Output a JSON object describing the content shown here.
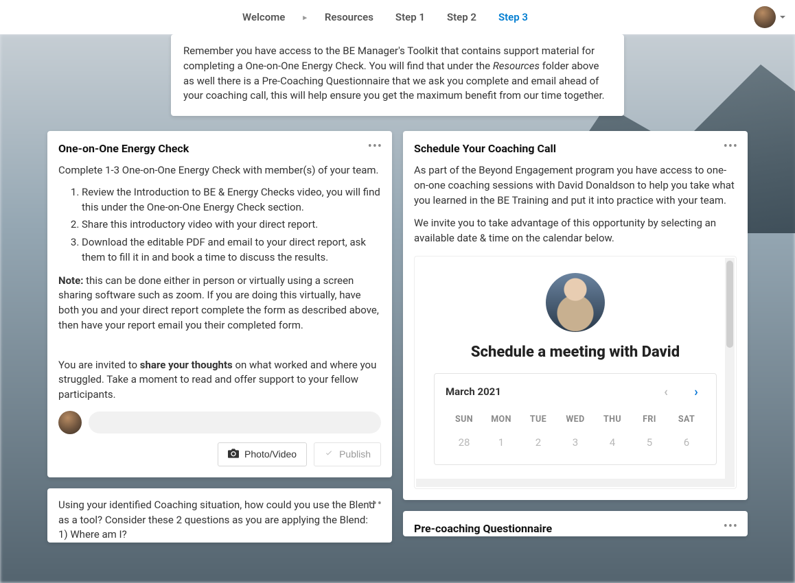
{
  "nav": {
    "items": [
      {
        "label": "Welcome"
      },
      {
        "label": "Resources"
      },
      {
        "label": "Step 1"
      },
      {
        "label": "Step 2"
      },
      {
        "label": "Step 3"
      }
    ],
    "active_index": 4
  },
  "intro": {
    "text_before": "Remember you have access to the BE Manager's Toolkit that contains support material for completing a One-on-One Energy Check. You will find that under the ",
    "resources_word": "Resources",
    "text_after": " folder above as well there is a Pre-Coaching Questionnaire that we ask you complete and email ahead of your coaching call, this will help ensure you get the maximum benefit from our time together."
  },
  "energy": {
    "title": "One-on-One Energy Check",
    "subtitle": "Complete 1-3 One-on-One Energy Check with member(s) of your team.",
    "steps": [
      "Review the Introduction to BE & Energy Checks video, you will find this under the One-on-One Energy Check section.",
      "Share this introductory video with your direct report.",
      "Download the editable PDF and email to your direct report, ask them to fill it in and book a time to discuss the results."
    ],
    "note_label": "Note:",
    "note_text": " this can be done either in person or virtually using a screen sharing software such as zoom. If you are doing this virtually, have both you and your direct report complete the form as described above, then have your report email you their completed form.",
    "invite_before": "You are invited to ",
    "invite_bold": "share your thoughts",
    "invite_after": " on what worked and where you struggled. Take a moment to read and offer support to your fellow participants.",
    "photo_btn": "Photo/Video",
    "publish_btn": "Publish"
  },
  "blend": {
    "line1": "Using your identified Coaching situation, how could you use the Blend as a tool? Consider these 2 questions as you are applying the Blend:",
    "line2": "1) Where am I?"
  },
  "schedule": {
    "title": "Schedule Your Coaching Call",
    "p1": "As part of the Beyond Engagement program you have access to one-on-one coaching sessions with David Donaldson to help you take what you learned in the BE Training and put it into practice with your team.",
    "p2": "We invite you to take advantage of this opportunity by selecting an available date & time on the calendar below.",
    "sched_heading": "Schedule a meeting with David",
    "month": "March 2021",
    "dow": [
      "SUN",
      "MON",
      "TUE",
      "WED",
      "THU",
      "FRI",
      "SAT"
    ],
    "row": [
      "28",
      "1",
      "2",
      "3",
      "4",
      "5",
      "6"
    ]
  },
  "precoach": {
    "title": "Pre-coaching Questionnaire"
  }
}
